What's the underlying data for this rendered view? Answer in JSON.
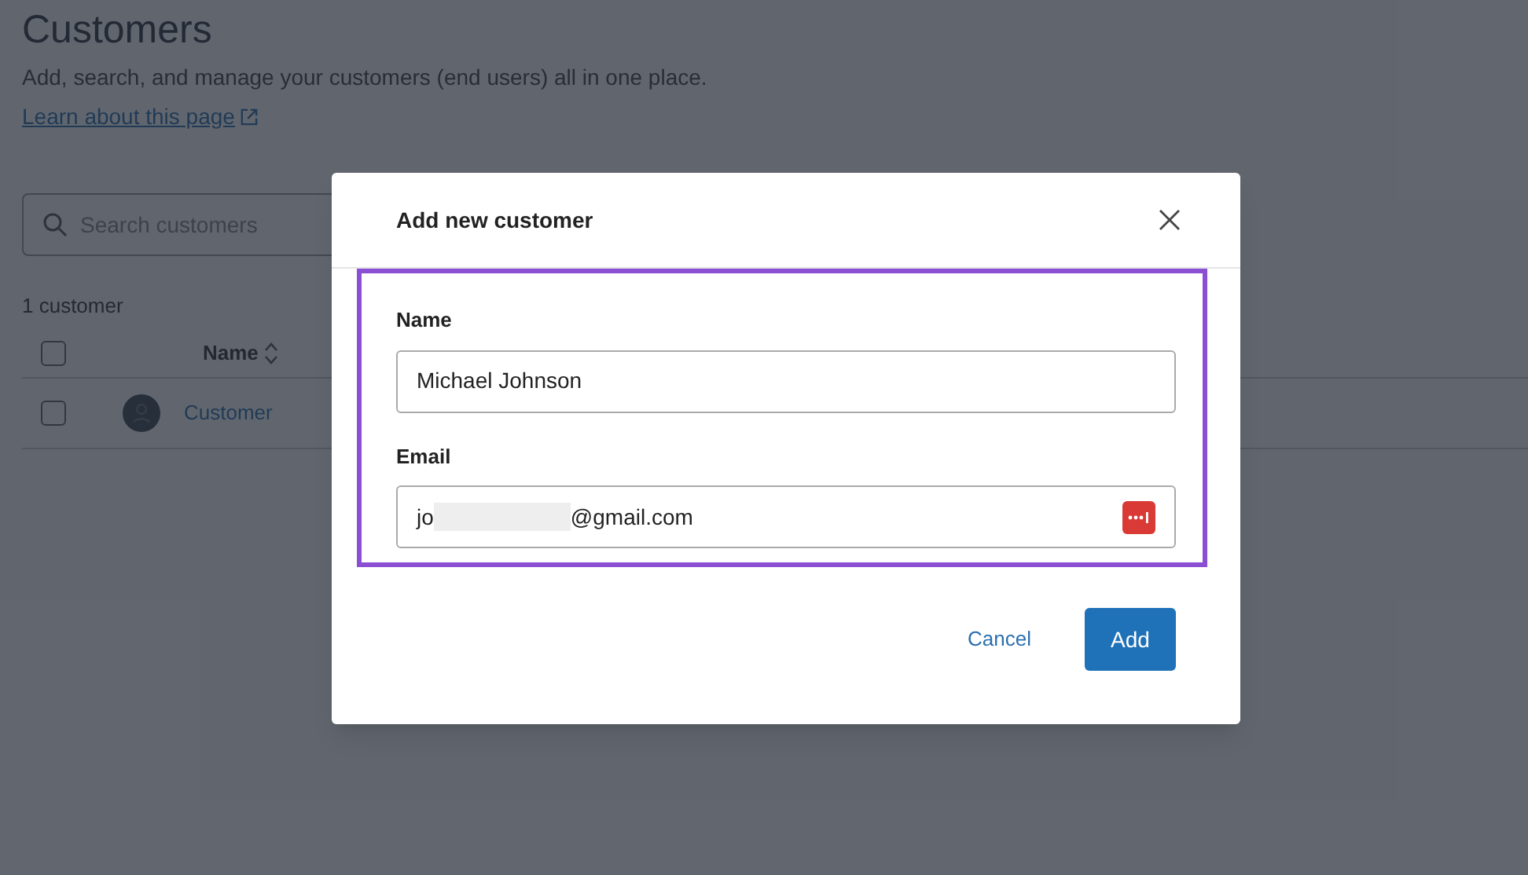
{
  "page": {
    "title": "Customers",
    "description": "Add, search, and manage your customers (end users) all in one place.",
    "learn_link": "Learn about this page"
  },
  "search": {
    "placeholder": "Search customers"
  },
  "count": "1 customer",
  "table": {
    "header_checked": false,
    "columns": [
      {
        "label": "Name",
        "sortable": true
      }
    ],
    "rows": [
      {
        "checked": false,
        "name": "Customer"
      }
    ]
  },
  "dialog": {
    "title": "Add new customer",
    "fields": [
      {
        "label": "Name",
        "value": "Michael Johnson",
        "kind": "text"
      },
      {
        "label": "Email",
        "value_parts": [
          "jo",
          "@gmail.com"
        ],
        "kind": "redacted"
      }
    ],
    "buttons": [
      {
        "label": "Cancel",
        "kind": "link"
      },
      {
        "label": "Add",
        "kind": "primary"
      }
    ]
  }
}
